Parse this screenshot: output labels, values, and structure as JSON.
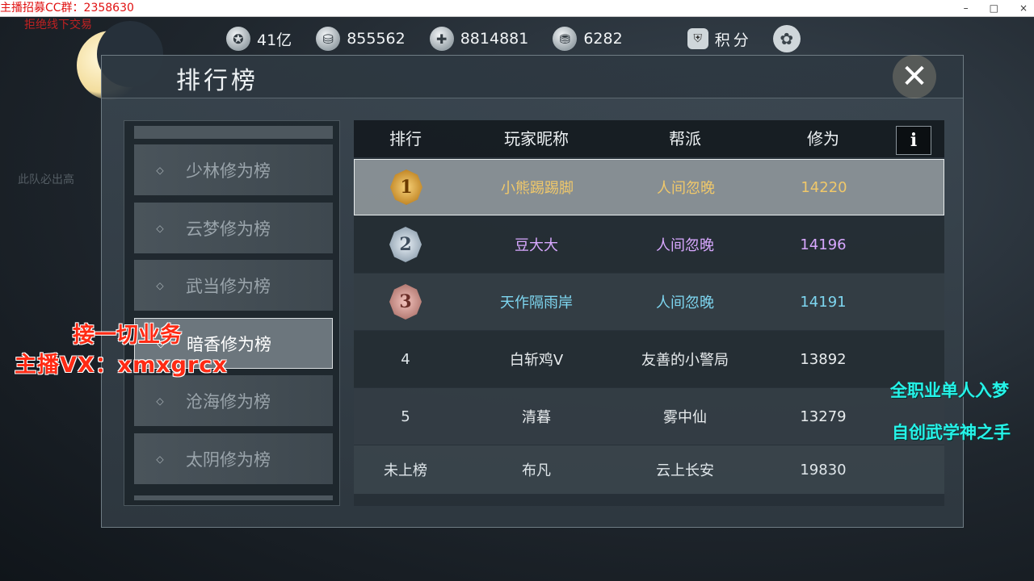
{
  "window": {
    "title_overlay": "主播招募CC群：2358630",
    "controls": [
      "–",
      "□",
      "×"
    ]
  },
  "overlays": {
    "top_left_red": "拒绝线下交易",
    "ghost_left": "此队必出高",
    "red_line1": "接一切业务",
    "red_line2": "主播VX：xmxgrcx",
    "cyan_line1": "全职业单人入梦",
    "cyan_line2": "自创武学神之手"
  },
  "topbar": {
    "resources": [
      {
        "icon": "coin-stack-icon",
        "glyph": "✪",
        "value": "41亿"
      },
      {
        "icon": "silver-ingot-icon",
        "glyph": "⛁",
        "value": "855562"
      },
      {
        "icon": "jade-ticket-icon",
        "glyph": "✚",
        "value": "8814881"
      },
      {
        "icon": "gold-ingot-icon",
        "glyph": "⛃",
        "value": "6282"
      }
    ],
    "points_label": "积分",
    "points_glyph": "⛨",
    "gear_glyph": "✿"
  },
  "panel": {
    "title": "排行榜",
    "close_glyph": "✕"
  },
  "sidebar": {
    "items": [
      {
        "label": "少林修为榜",
        "active": false
      },
      {
        "label": "云梦修为榜",
        "active": false
      },
      {
        "label": "武当修为榜",
        "active": false
      },
      {
        "label": "暗香修为榜",
        "active": true
      },
      {
        "label": "沧海修为榜",
        "active": false
      },
      {
        "label": "太阴修为榜",
        "active": false
      }
    ],
    "bullet": "◇"
  },
  "table": {
    "headers": {
      "rank": "排行",
      "name": "玩家昵称",
      "guild": "帮派",
      "score": "修为"
    },
    "info_label": "i",
    "rows": [
      {
        "rank": "1",
        "medal": "gold",
        "name": "小熊踢踢脚",
        "guild": "人间忽晚",
        "score": "14220",
        "name_color": "#f0c86a",
        "guild_color": "#f0c86a",
        "score_color": "#f0c86a"
      },
      {
        "rank": "2",
        "medal": "silver",
        "name": "豆大大",
        "guild": "人间忽晚",
        "score": "14196",
        "name_color": "#d8a8ff",
        "guild_color": "#d8a8ff",
        "score_color": "#d8a8ff"
      },
      {
        "rank": "3",
        "medal": "bronze",
        "name": "天作隔雨岸",
        "guild": "人间忽晚",
        "score": "14191",
        "name_color": "#7ed6f0",
        "guild_color": "#7ed6f0",
        "score_color": "#7ed6f0"
      },
      {
        "rank": "4",
        "medal": "",
        "name": "白斩鸡ᐯ",
        "guild": "友善的小警局",
        "score": "13892",
        "name_color": "#e8ecee",
        "guild_color": "#e8ecee",
        "score_color": "#e8ecee"
      },
      {
        "rank": "5",
        "medal": "",
        "name": "清暮",
        "guild": "雾中仙",
        "score": "13279",
        "name_color": "#e8ecee",
        "guild_color": "#e8ecee",
        "score_color": "#e8ecee"
      }
    ],
    "self_row": {
      "rank": "未上榜",
      "name": "布凡",
      "guild": "云上长安",
      "score": "19830"
    }
  }
}
